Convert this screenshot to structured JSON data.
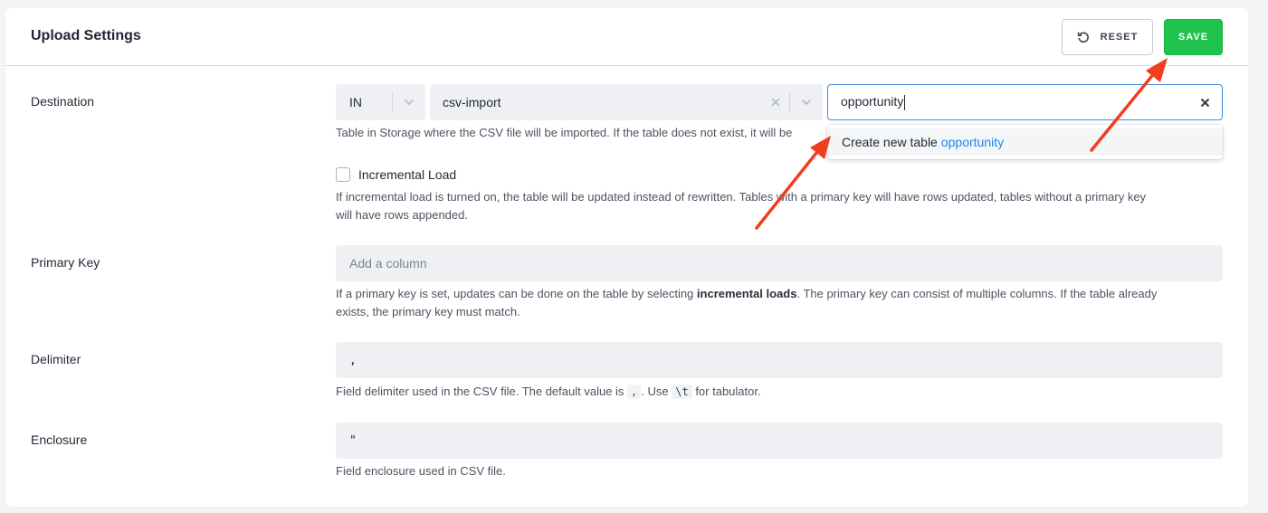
{
  "header": {
    "title": "Upload Settings",
    "reset_label": "RESET",
    "save_label": "SAVE"
  },
  "destination": {
    "label": "Destination",
    "stage_value": "IN",
    "bucket_value": "csv-import",
    "table_value": "opportunity",
    "help": "Table in Storage where the CSV file will be imported. If the table does not exist, it will be",
    "dropdown": {
      "option_prefix": "Create new table",
      "option_name": "opportunity"
    }
  },
  "incremental": {
    "label": "Incremental Load",
    "checked": false,
    "help_line1": "If incremental load is turned on, the table will be updated instead of rewritten. Tables with a primary key will have rows updated, tables without a primary key",
    "help_line2": "will have rows appended."
  },
  "primary_key": {
    "label": "Primary Key",
    "placeholder": "Add a column",
    "help_part1": "If a primary key is set, updates can be done on the table by selecting ",
    "help_bold": "incremental loads",
    "help_part2": ". The primary key can consist of multiple columns. If the table already",
    "help_line2": "exists, the primary key must match."
  },
  "delimiter": {
    "label": "Delimiter",
    "value": ",",
    "help_part1": "Field delimiter used in the CSV file. The default value is ",
    "default_code": ",",
    "help_part2": ". Use ",
    "tab_code": "\\t",
    "help_part3": " for tabulator."
  },
  "enclosure": {
    "label": "Enclosure",
    "value": "\"",
    "help": "Field enclosure used in CSV file."
  },
  "colors": {
    "save_button": "#1fc24b",
    "focus_border": "#3c8be0",
    "highlight_link": "#1e87f0",
    "annotation_arrow": "#f23d1f"
  }
}
